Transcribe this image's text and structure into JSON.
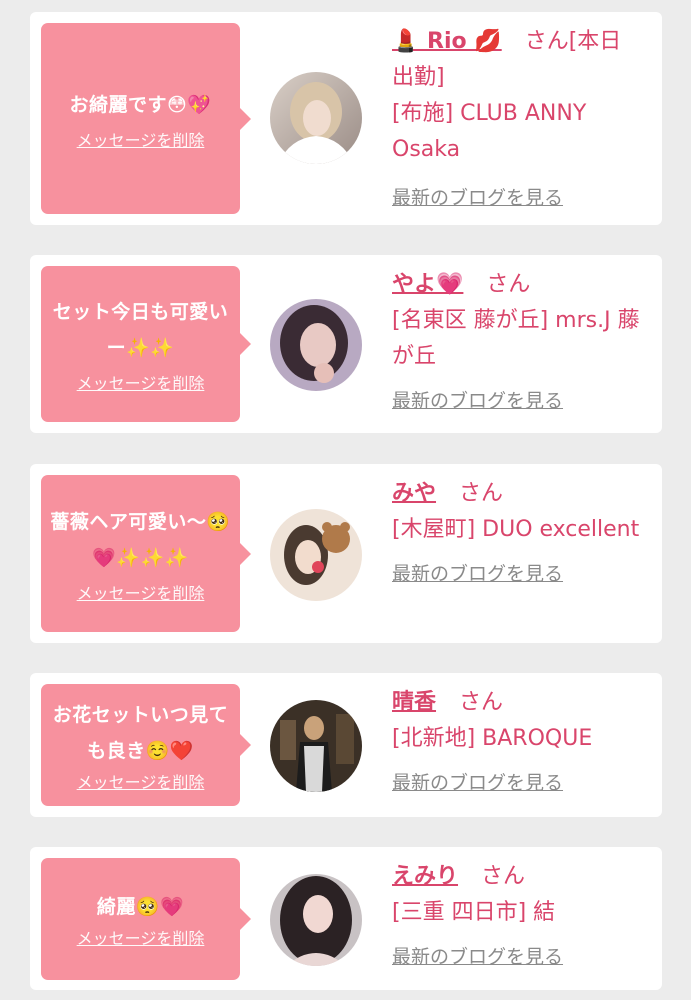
{
  "common": {
    "delete_label": "メッセージを削除",
    "blog_label": "最新のブログを見る",
    "honorific": "さん"
  },
  "colors": {
    "background": "#ececec",
    "card": "#ffffff",
    "bubble": "#f7919e",
    "accent_text": "#d9456b",
    "link_gray": "#8a8a8a"
  },
  "messages": [
    {
      "text": "お綺麗です😳💖",
      "name": "💄 Rio 💋",
      "name_suffix": "さん[本日出勤]",
      "shop": "[布施] CLUB ANNY Osaka",
      "avatar": "avatar-woman-blonde"
    },
    {
      "text": "セット今日も可愛いー✨✨",
      "name": "やよ💗",
      "name_suffix": "さん",
      "shop": "[名東区 藤が丘] mrs.J 藤が丘",
      "avatar": "avatar-woman-winking"
    },
    {
      "text": "薔薇ヘア可愛い〜🥺💗✨✨✨",
      "name": "みや",
      "name_suffix": "さん",
      "shop": "[木屋町] DUO excellent",
      "avatar": "avatar-woman-bear-sticker"
    },
    {
      "text": "お花セットいつ見ても良き☺️❤️",
      "name": "晴香",
      "name_suffix": "さん",
      "shop": "[北新地] BAROQUE",
      "avatar": "avatar-woman-dress"
    },
    {
      "text": "綺麗🥺💗",
      "name": "えみり",
      "name_suffix": "さん",
      "shop": "[三重 四日市] 結",
      "avatar": "avatar-woman-curls"
    }
  ]
}
